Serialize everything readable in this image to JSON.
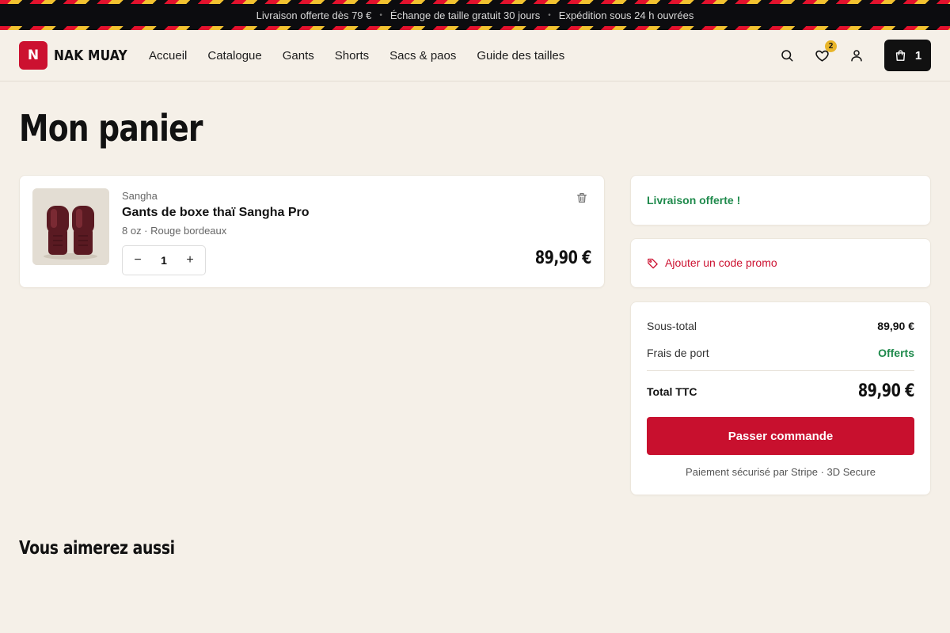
{
  "topbar": {
    "messages": [
      "Livraison offerte dès 79 €",
      "Échange de taille gratuit 30 jours",
      "Expédition sous 24 h ouvrées"
    ],
    "separator": "•"
  },
  "brand": {
    "logo_letter": "N",
    "name": "NAK MUAY",
    "accent": "#cc1130"
  },
  "nav": {
    "items": [
      "Accueil",
      "Catalogue",
      "Gants",
      "Shorts",
      "Sacs & paos",
      "Guide des tailles"
    ]
  },
  "actions": {
    "icons": [
      "search-icon",
      "heart-icon",
      "user-icon",
      "cart-icon"
    ],
    "wishlist_count": "2",
    "cart_count": "1"
  },
  "page": {
    "title": "Mon panier",
    "also_title": "Vous aimerez aussi"
  },
  "cart": {
    "items": [
      {
        "brand": "Sangha",
        "name": "Gants de boxe thaï Sangha Pro",
        "variant": "8 oz · Rouge bordeaux",
        "quantity": "1",
        "minus": "−",
        "plus": "+",
        "price": "89,90 €",
        "image": "burgundy-boxing-gloves"
      }
    ]
  },
  "shipping_notice": {
    "text": "Livraison offerte !",
    "color": "#1f8a4c"
  },
  "promo": {
    "label": "Ajouter un code promo",
    "icon": "tag-icon"
  },
  "summary": {
    "subtotal_label": "Sous-total",
    "subtotal_value": "89,90 €",
    "shipping_label": "Frais de port",
    "shipping_value": "Offerts",
    "total_label": "Total TTC",
    "total_value": "89,90 €",
    "checkout_label": "Passer commande",
    "secure_note": "Paiement sécurisé par Stripe · 3D Secure",
    "button_color": "#c8102e"
  }
}
